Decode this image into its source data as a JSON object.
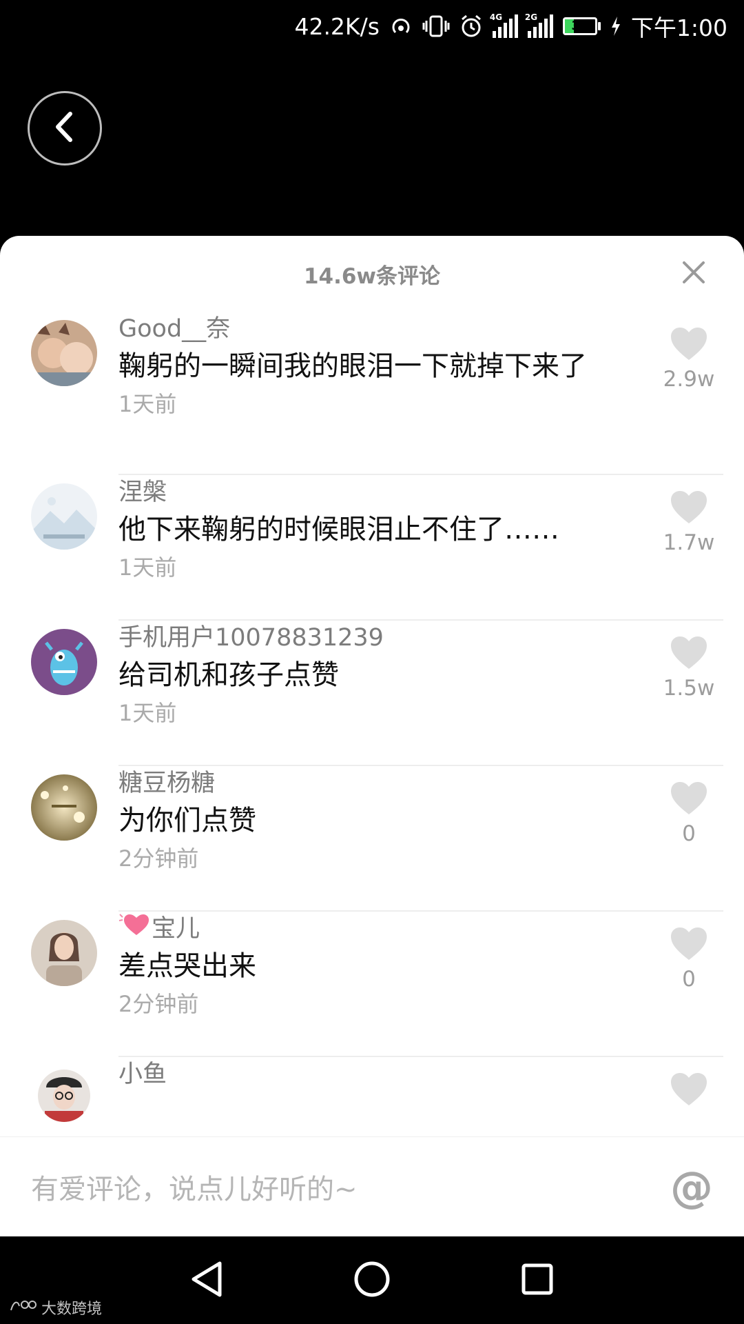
{
  "status_bar": {
    "speed": "42.2K/s",
    "signal1_label": "4G",
    "signal2_label": "2G",
    "battery": "30",
    "time": "下午1:00"
  },
  "sheet": {
    "title": "14.6w条评论"
  },
  "comments": [
    {
      "username": "Good__奈",
      "text": "鞠躬的一瞬间我的眼泪一下就掉下来了",
      "time": "1天前",
      "likes": "2.9w"
    },
    {
      "username": "涅槃",
      "text": "他下来鞠躬的时候眼泪止不住了……",
      "time": "1天前",
      "likes": "1.7w"
    },
    {
      "username": "手机用户10078831239",
      "text": "给司机和孩子点赞",
      "time": "1天前",
      "likes": "1.5w"
    },
    {
      "username": "糖豆杨糖",
      "text": "为你们点赞",
      "time": "2分钟前",
      "likes": "0"
    },
    {
      "username": "宝儿",
      "text": "差点哭出来",
      "time": "2分钟前",
      "likes": "0"
    },
    {
      "username": "小鱼",
      "text": "",
      "time": "",
      "likes": ""
    }
  ],
  "input": {
    "placeholder": "有爱评论，说点儿好听的~",
    "at_symbol": "@"
  },
  "watermark": "大数跨境",
  "colors": {
    "heart": "#dcdcdc",
    "battery_fill": "#3dd65c"
  }
}
